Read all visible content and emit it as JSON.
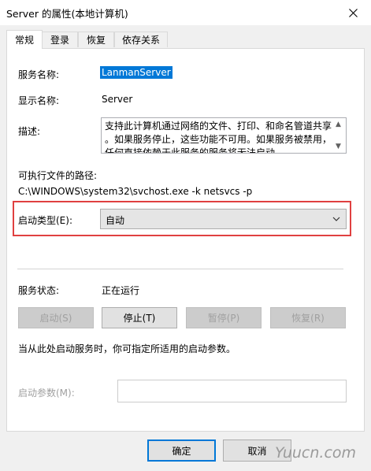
{
  "window": {
    "title": "Server 的属性(本地计算机)",
    "close_icon": "close-icon"
  },
  "tabs": [
    {
      "label": "常规",
      "active": true
    },
    {
      "label": "登录",
      "active": false
    },
    {
      "label": "恢复",
      "active": false
    },
    {
      "label": "依存关系",
      "active": false
    }
  ],
  "general": {
    "service_name_label": "服务名称:",
    "service_name_value": "LanmanServer",
    "display_name_label": "显示名称:",
    "display_name_value": "Server",
    "description_label": "描述:",
    "description_lines": [
      "支持此计算机通过网络的文件、打印、和命名管道共享",
      "。如果服务停止，这些功能不可用。如果服务被禁用，",
      "任何直接依赖于此服务的服务将无法启动。"
    ],
    "exe_path_label": "可执行文件的路径:",
    "exe_path_value": "C:\\WINDOWS\\system32\\svchost.exe -k netsvcs -p",
    "startup_type_label": "启动类型(E):",
    "startup_type_value": "自动",
    "status_label": "服务状态:",
    "status_value": "正在运行",
    "buttons": {
      "start": "启动(S)",
      "stop": "停止(T)",
      "pause": "暂停(P)",
      "resume": "恢复(R)"
    },
    "hint": "当从此处启动服务时，你可指定所适用的启动参数。",
    "start_params_label": "启动参数(M):",
    "start_params_value": ""
  },
  "footer": {
    "ok": "确定",
    "cancel": "取消",
    "watermark": "Yuucn.com"
  }
}
